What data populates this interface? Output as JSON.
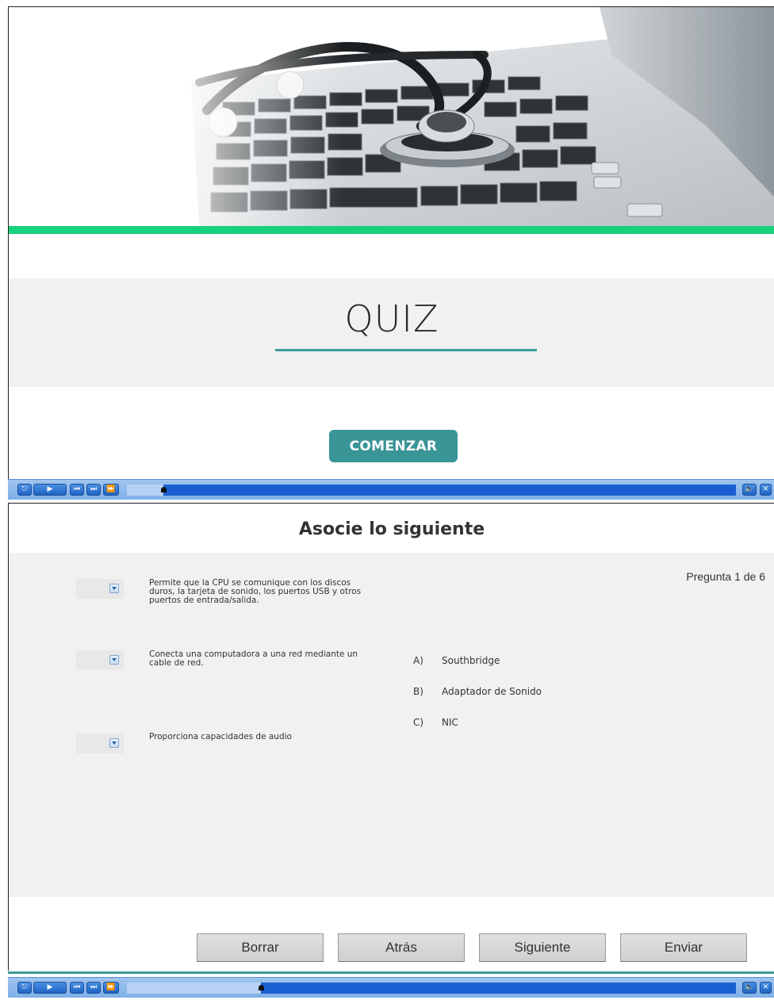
{
  "slide1": {
    "quiz_title": "QUIZ",
    "start_button": "COMENZAR"
  },
  "slide2": {
    "heading": "Asocie lo siguiente",
    "counter": "Pregunta 1 de 6",
    "statements": [
      "Permite que la CPU se comunique con los discos duros, la tarjeta de sonido, los puertos USB y otros puertos de entrada/salida.",
      "Conecta una computadora a una red mediante un cable de red.",
      "Proporciona capacidades de audio"
    ],
    "options": [
      {
        "key": "A)",
        "label": "Southbridge"
      },
      {
        "key": "B)",
        "label": "Adaptador de Sonido"
      },
      {
        "key": "C)",
        "label": "NIC"
      }
    ],
    "buttons": {
      "clear": "Borrar",
      "back": "Atrás",
      "next": "Siguiente",
      "submit": "Enviar"
    }
  },
  "player": {
    "icons": [
      "exit-icon",
      "play-icon",
      "rewind-icon",
      "forward-icon",
      "fast-forward-icon",
      "volume-icon",
      "close-icon"
    ],
    "slide1_progress": 0.06,
    "slide2_progress": 0.22
  },
  "colors": {
    "accent_green": "#17d27c",
    "teal": "#3a9597",
    "player_blue": "#1a5fd1"
  }
}
